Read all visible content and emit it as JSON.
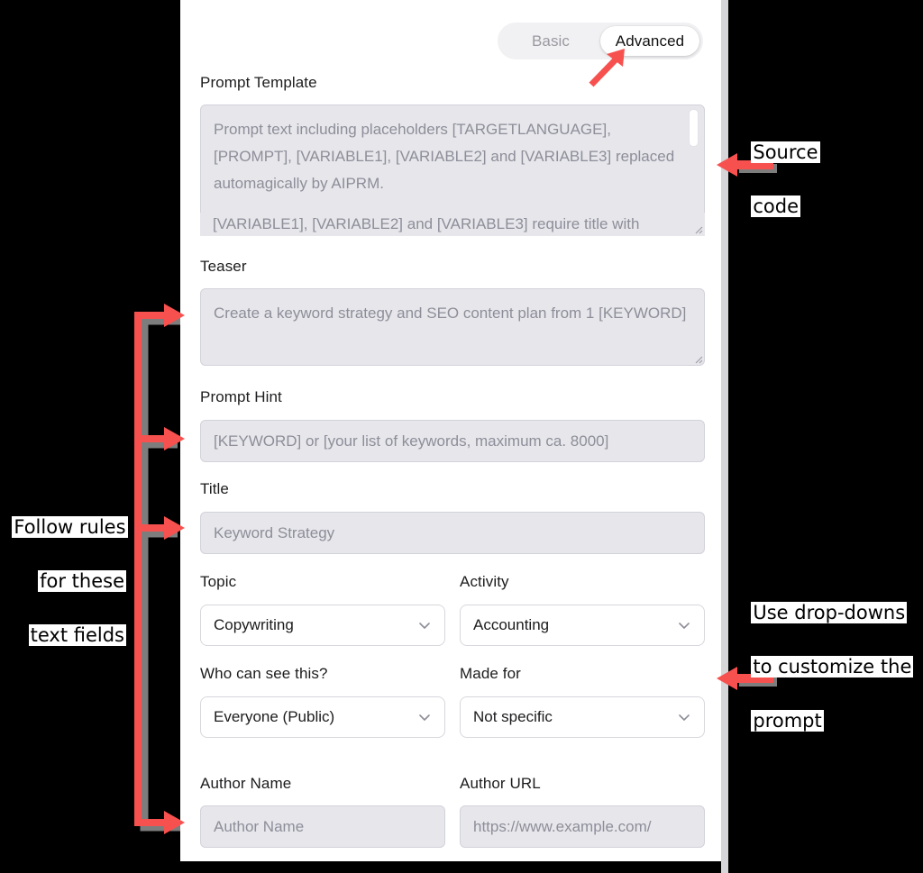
{
  "toggle": {
    "basic_label": "Basic",
    "advanced_label": "Advanced",
    "selected": "Advanced"
  },
  "form": {
    "prompt_template": {
      "label": "Prompt Template",
      "placeholder": "Prompt text including placeholders [TARGETLANGUAGE], [PROMPT], [VARIABLE1], [VARIABLE2] and [VARIABLE3] replaced automagically by AIPRM.",
      "placeholder_line2": "[VARIABLE1], [VARIABLE2] and [VARIABLE3] require title with",
      "value": ""
    },
    "teaser": {
      "label": "Teaser",
      "placeholder": "Create a keyword strategy and SEO content plan from 1 [KEYWORD]",
      "value": ""
    },
    "prompt_hint": {
      "label": "Prompt Hint",
      "placeholder": "[KEYWORD] or [your list of keywords, maximum ca. 8000]",
      "value": ""
    },
    "title": {
      "label": "Title",
      "placeholder": "Keyword Strategy",
      "value": ""
    },
    "topic": {
      "label": "Topic",
      "value": "Copywriting"
    },
    "activity": {
      "label": "Activity",
      "value": "Accounting"
    },
    "visibility": {
      "label": "Who can see this?",
      "value": "Everyone (Public)"
    },
    "made_for": {
      "label": "Made for",
      "value": "Not specific"
    },
    "author_name": {
      "label": "Author Name",
      "placeholder": "Author Name",
      "value": ""
    },
    "author_url": {
      "label": "Author URL",
      "placeholder": "https://www.example.com/",
      "value": ""
    }
  },
  "annotations": {
    "source_code": {
      "line1": "Source",
      "line2": "code"
    },
    "dropdowns": {
      "line1": "Use drop-downs",
      "line2": "to customize the",
      "line3": "prompt"
    },
    "text_fields": {
      "line1": "Follow rules",
      "line2": "for these",
      "line3": "text fields"
    },
    "arrow_color": "#f7514f"
  }
}
